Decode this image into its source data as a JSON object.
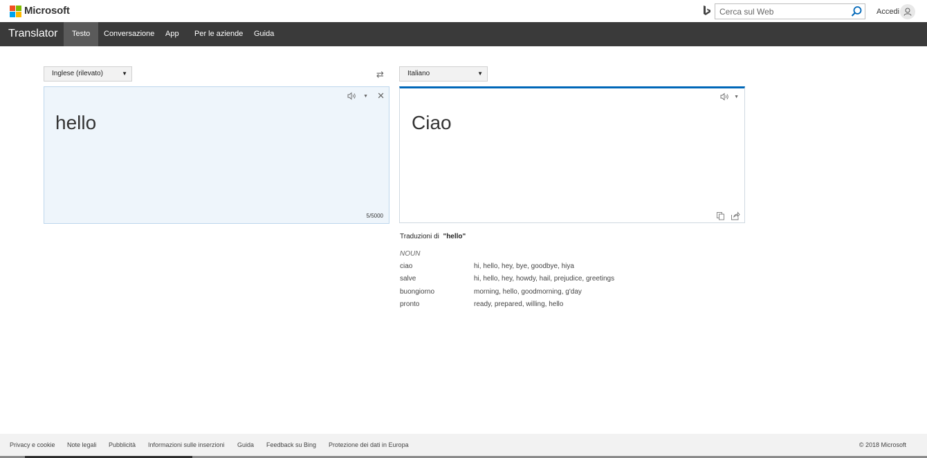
{
  "header": {
    "brand": "Microsoft",
    "search_placeholder": "Cerca sul Web",
    "signin_label": "Accedi"
  },
  "nav": {
    "app_title": "Translator",
    "tabs": [
      {
        "label": "Testo",
        "active": true
      },
      {
        "label": "Conversazione",
        "active": false
      },
      {
        "label": "App",
        "active": false
      },
      {
        "label": "Per le aziende",
        "active": false
      },
      {
        "label": "Guida",
        "active": false
      }
    ]
  },
  "translator": {
    "source_lang": "Inglese (rilevato)",
    "target_lang": "Italiano",
    "source_text": "hello",
    "target_text": "Ciao",
    "char_count": "5/5000"
  },
  "dictionary": {
    "title_prefix": "Traduzioni di",
    "title_word": "\"hello\"",
    "part_of_speech": "NOUN",
    "entries": [
      {
        "word": "ciao",
        "synonyms": "hi, hello, hey, bye, goodbye, hiya"
      },
      {
        "word": "salve",
        "synonyms": "hi, hello, hey, howdy, hail, prejudice, greetings"
      },
      {
        "word": "buongiorno",
        "synonyms": "morning, hello, goodmorning, g'day"
      },
      {
        "word": "pronto",
        "synonyms": "ready, prepared, willing, hello"
      }
    ]
  },
  "footer": {
    "links": [
      "Privacy e cookie",
      "Note legali",
      "Pubblicità",
      "Informazioni sulle inserzioni",
      "Guida",
      "Feedback su Bing",
      "Protezione dei dati in Europa"
    ],
    "copyright": "© 2018 Microsoft"
  },
  "colors": {
    "accent": "#0067b8",
    "navbar": "#3a3a3a",
    "source_bg": "#eef5fb"
  },
  "icons": [
    "microsoft-logo",
    "bing-icon",
    "search-icon",
    "user-icon",
    "swap-icon",
    "speaker-icon",
    "chevron-down-icon",
    "close-icon",
    "copy-icon",
    "share-icon"
  ]
}
